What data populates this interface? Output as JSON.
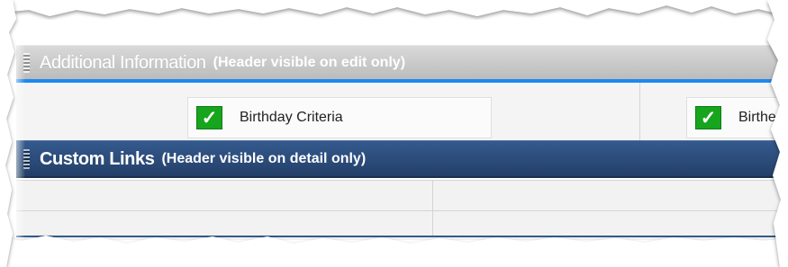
{
  "sections": {
    "additional_information": {
      "title": "Additional Information",
      "visibility_note": "(Header visible on edit only)",
      "fields": [
        {
          "label": "Birthday Criteria",
          "checked": true
        },
        {
          "label": "Birthe",
          "checked": true
        }
      ]
    },
    "custom_links": {
      "title": "Custom Links",
      "visibility_note": "(Header visible on detail only)"
    }
  },
  "icons": {
    "checkmark": "✓",
    "drag_handle": "drag-handle-icon"
  },
  "colors": {
    "additional_header_top": "#d9d9d9",
    "additional_header_bottom": "#bcbcbc",
    "custom_header_top": "#345a8e",
    "custom_header_bottom": "#243f68",
    "blue_rule": "#1f88f0",
    "checkbox_green": "#16a51d"
  }
}
